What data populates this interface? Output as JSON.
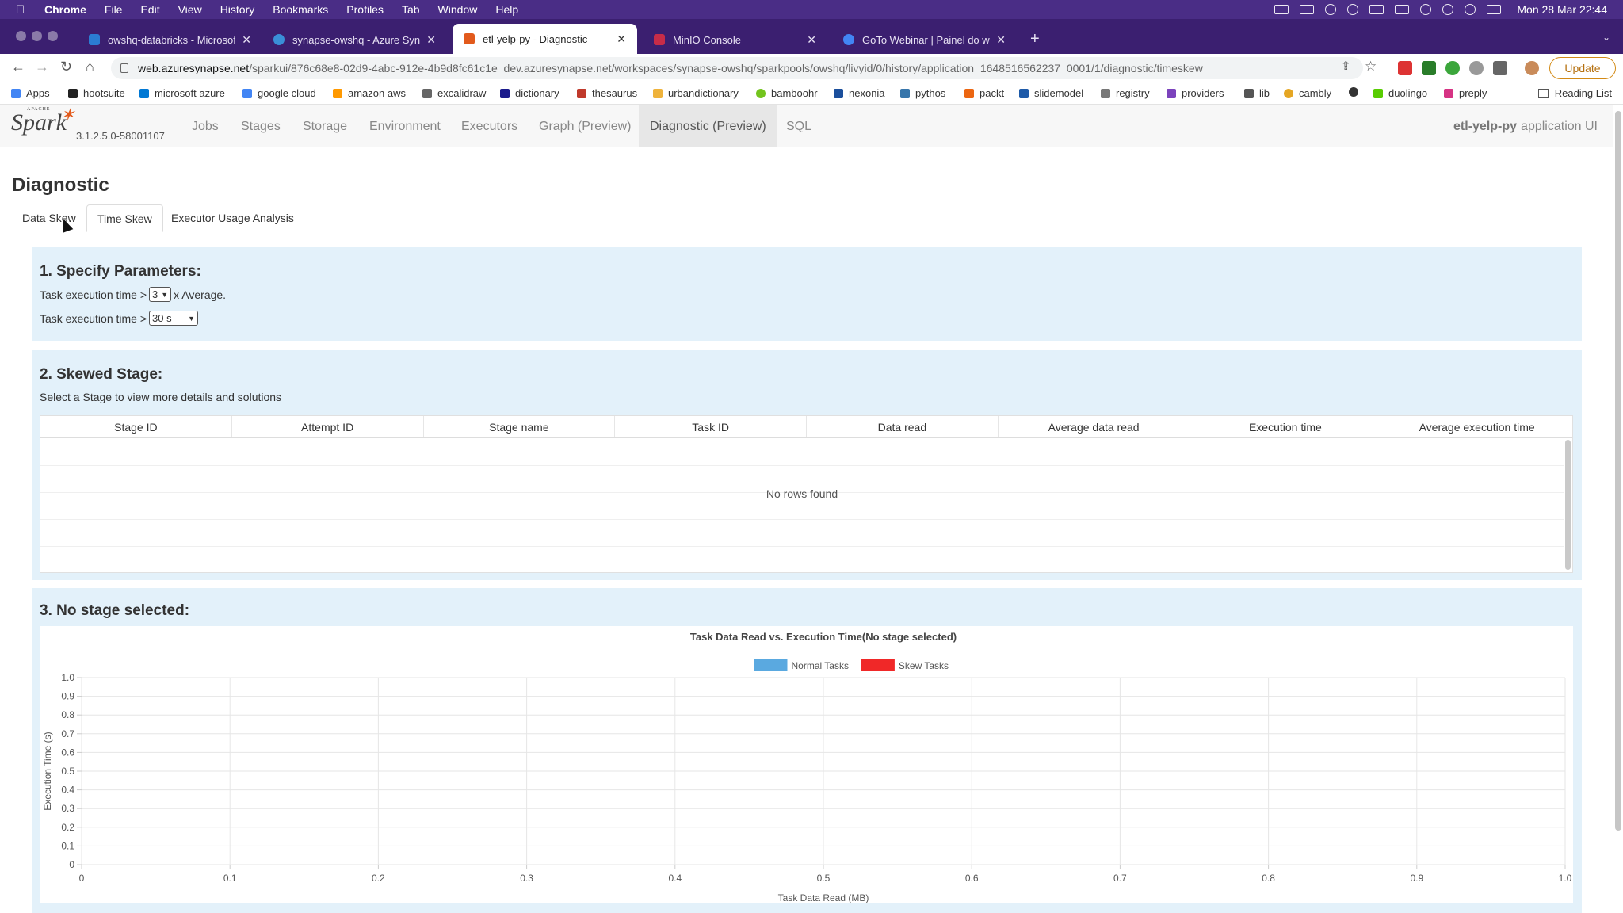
{
  "menubar": {
    "app": "Chrome",
    "items": [
      "File",
      "Edit",
      "View",
      "History",
      "Bookmarks",
      "Profiles",
      "Tab",
      "Window",
      "Help"
    ],
    "clock": "Mon 28 Mar  22:44"
  },
  "tabs": [
    {
      "title": "owshq-databricks - Microsoft Azure",
      "color": "#2b7cd3"
    },
    {
      "title": "synapse-owshq - Azure Synapse Analytics",
      "color": "#3a8fd8"
    },
    {
      "title": "etl-yelp-py - Diagnostic",
      "color": "#e25a1c"
    },
    {
      "title": "MinIO Console",
      "color": "#c72c48"
    },
    {
      "title": "GoTo Webinar | Painel do webinar",
      "color": "#4285f4"
    }
  ],
  "address": {
    "host": "web.azuresynapse.net",
    "path": "/sparkui/876c68e8-02d9-4abc-912e-4b9d8fc61c1e_dev.azuresynapse.net/workspaces/synapse-owshq/sparkpools/owshq/livyid/0/history/application_1648516562237_0001/1/diagnostic/timeskew",
    "update": "Update"
  },
  "bookmarks": [
    {
      "label": "Apps",
      "color": "#4285f4"
    },
    {
      "label": "hootsuite",
      "color": "#222"
    },
    {
      "label": "microsoft azure",
      "color": "#0078d4"
    },
    {
      "label": "google cloud",
      "color": "#4285f4"
    },
    {
      "label": "amazon aws",
      "color": "#ff9900"
    },
    {
      "label": "excalidraw",
      "color": "#666"
    },
    {
      "label": "dictionary",
      "color": "#1a1a8c"
    },
    {
      "label": "thesaurus",
      "color": "#c0392b"
    },
    {
      "label": "urbandictionary",
      "color": "#efb33b"
    },
    {
      "label": "bamboohr",
      "color": "#73c41d"
    },
    {
      "label": "nexonia",
      "color": "#1b4f9c"
    },
    {
      "label": "pythos",
      "color": "#3776ab"
    },
    {
      "label": "packt",
      "color": "#ec6611"
    },
    {
      "label": "slidemodel",
      "color": "#1d5aa8"
    },
    {
      "label": "registry",
      "color": "#777"
    },
    {
      "label": "providers",
      "color": "#7b42bc"
    },
    {
      "label": "lib",
      "color": "#555"
    },
    {
      "label": "cambly",
      "color": "#e5a623"
    },
    {
      "label": "",
      "color": "#333"
    },
    {
      "label": "duolingo",
      "color": "#58cc02"
    },
    {
      "label": "preply",
      "color": "#d63384"
    }
  ],
  "reading_list": "Reading List",
  "spark": {
    "version": "3.1.2.5.0-58001107",
    "nav": [
      "Jobs",
      "Stages",
      "Storage",
      "Environment",
      "Executors",
      "Graph (Preview)",
      "Diagnostic (Preview)",
      "SQL"
    ],
    "app_name": "etl-yelp-py",
    "app_suffix": "application UI"
  },
  "page": {
    "title": "Diagnostic",
    "tabs": [
      "Data Skew",
      "Time Skew",
      "Executor Usage Analysis"
    ],
    "active_tab": "Time Skew"
  },
  "params": {
    "heading": "1. Specify Parameters:",
    "line1_prefix": "Task execution time >",
    "line1_value": "3",
    "line1_suffix": "x Average.",
    "line2_prefix": "Task execution time >",
    "line2_value": "30 s"
  },
  "skewed": {
    "heading": "2. Skewed Stage:",
    "hint": "Select a Stage to view more details and solutions",
    "columns": [
      "Stage ID",
      "Attempt ID",
      "Stage name",
      "Task ID",
      "Data read",
      "Average data read",
      "Execution time",
      "Average execution time"
    ],
    "empty": "No rows found"
  },
  "stage_panel": {
    "heading": "3. No stage selected:"
  },
  "chart_data": {
    "type": "scatter",
    "title": "Task Data Read vs. Execution Time(No stage selected)",
    "xlabel": "Task Data Read (MB)",
    "ylabel": "Execution Time (s)",
    "xlim": [
      0,
      1.0
    ],
    "ylim": [
      0,
      1.0
    ],
    "xticks": [
      "0",
      "0.1",
      "0.2",
      "0.3",
      "0.4",
      "0.5",
      "0.6",
      "0.7",
      "0.8",
      "0.9",
      "1.0"
    ],
    "yticks": [
      "0",
      "0.1",
      "0.2",
      "0.3",
      "0.4",
      "0.5",
      "0.6",
      "0.7",
      "0.8",
      "0.9",
      "1.0"
    ],
    "grid": true,
    "legend_position": "top",
    "series": [
      {
        "name": "Normal Tasks",
        "color": "#5aa9e0",
        "points": []
      },
      {
        "name": "Skew Tasks",
        "color": "#f02828",
        "points": []
      }
    ]
  }
}
